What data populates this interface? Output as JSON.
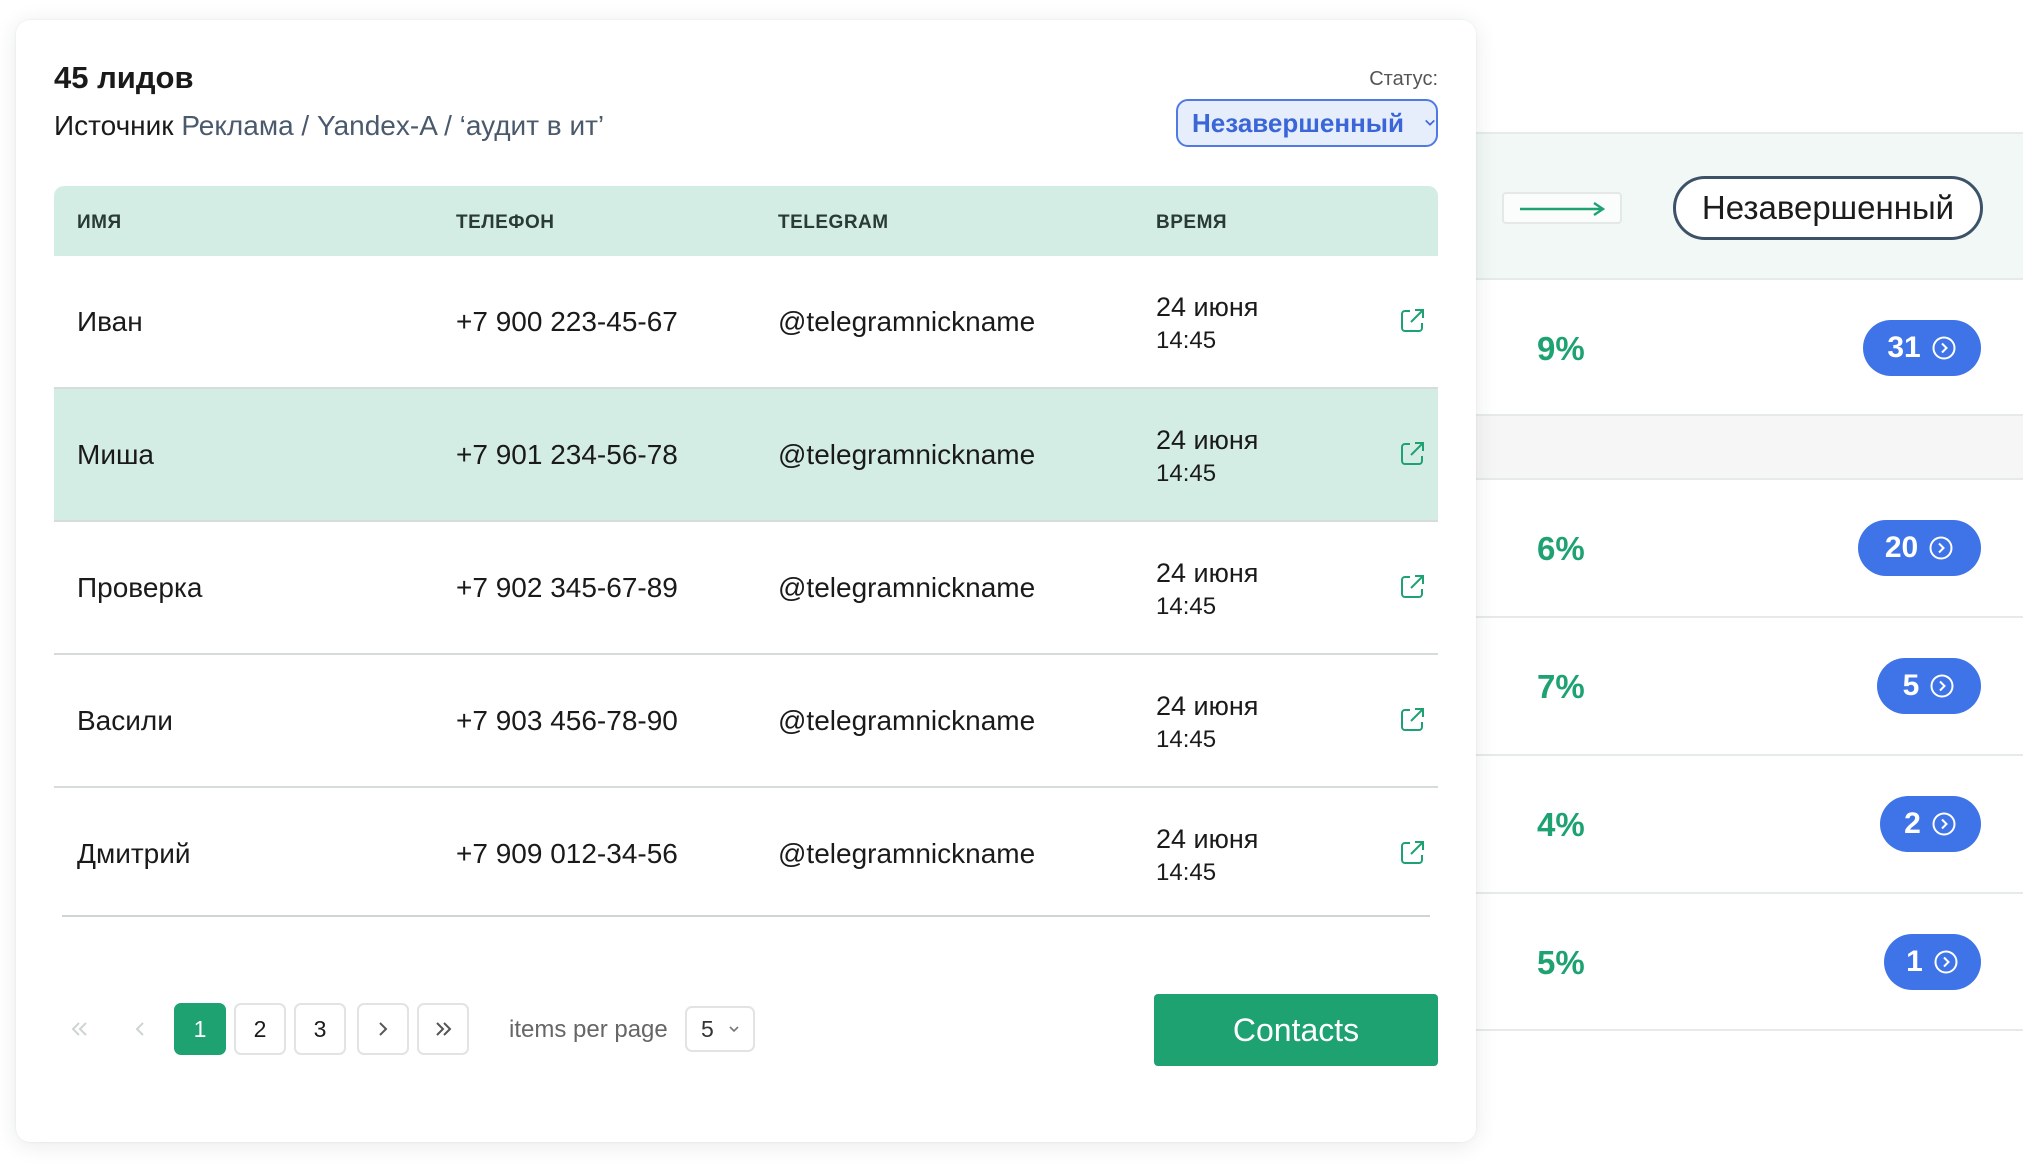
{
  "header": {
    "leads_count": "45 лидов",
    "source_label": "Источник",
    "source_value": "Реклама / Yandex-A / ‘аудит в ит’",
    "status_label": "Статус:",
    "status_value": "Незавершенный"
  },
  "table": {
    "columns": [
      "ИМЯ",
      "ТЕЛЕФОН",
      "TELEGRAM",
      "ВРЕМЯ"
    ],
    "rows": [
      {
        "name": "Иван",
        "phone": "+7 900 223-45-67",
        "telegram": "@telegramnickname",
        "date": "24 июня",
        "time": "14:45"
      },
      {
        "name": "Миша",
        "phone": "+7 901 234-56-78",
        "telegram": "@telegramnickname",
        "date": "24 июня",
        "time": "14:45"
      },
      {
        "name": "Проверка",
        "phone": "+7 902 345-67-89",
        "telegram": "@telegramnickname",
        "date": "24 июня",
        "time": "14:45"
      },
      {
        "name": "Васили",
        "phone": "+7 903 456-78-90",
        "telegram": "@telegramnickname",
        "date": "24 июня",
        "time": "14:45"
      },
      {
        "name": "Дмитрий",
        "phone": "+7 909 012-34-56",
        "telegram": "@telegramnickname",
        "date": "24 июня",
        "time": "14:45"
      }
    ],
    "highlighted_row": 1
  },
  "pagination": {
    "first_icon": "double-chevron-left-icon",
    "prev_icon": "chevron-left-icon",
    "pages": [
      "1",
      "2",
      "3"
    ],
    "current_page": "1",
    "next_icon": "chevron-right-icon",
    "last_icon": "double-chevron-right-icon",
    "items_per_page_label": "items per page",
    "items_per_page_value": "5"
  },
  "contacts_button": "Contacts",
  "background_panel": {
    "status_value": "Незавершенный",
    "rows": [
      {
        "percent": "9%",
        "count": "31"
      },
      {
        "percent": "6%",
        "count": "20"
      },
      {
        "percent": "7%",
        "count": "5"
      },
      {
        "percent": "4%",
        "count": "2"
      },
      {
        "percent": "5%",
        "count": "1"
      }
    ]
  },
  "colors": {
    "accent_green": "#1ea272",
    "table_header_bg": "#d4ede4",
    "status_blue": "#3a66d8",
    "badge_blue": "#3f74e8"
  }
}
